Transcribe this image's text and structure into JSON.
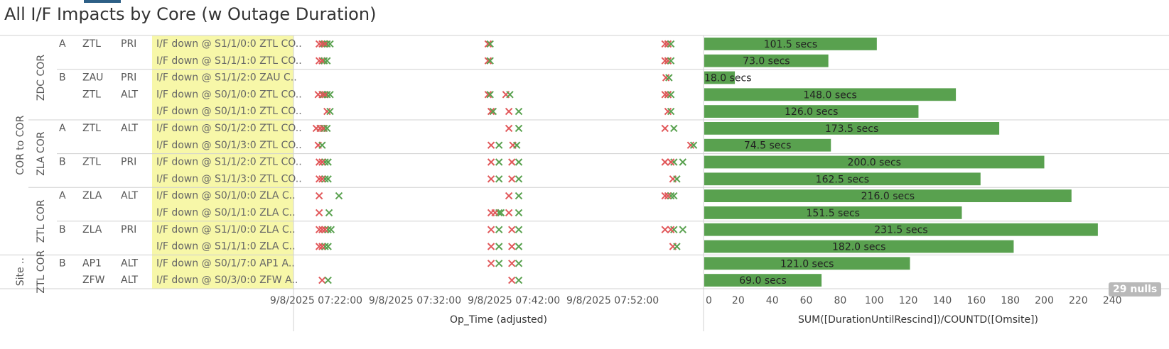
{
  "title": "All I/F Impacts by Core (w Outage Duration)",
  "null_badge": "29 nulls",
  "colors": {
    "bar": "#59a14f",
    "down_x": "#e15759",
    "up_x": "#59a14f",
    "highlight": "#f7f7a8"
  },
  "groups": [
    {
      "label": "COR to COR",
      "sub": [
        {
          "label": "ZDC COR",
          "sides": [
            {
              "label": "A",
              "rows": [
                0,
                1
              ]
            },
            {
              "label": "B",
              "rows": [
                2,
                3,
                4
              ]
            }
          ]
        },
        {
          "label": "ZLA COR",
          "sides": [
            {
              "label": "A",
              "rows": [
                5,
                6
              ]
            },
            {
              "label": "B",
              "rows": [
                7,
                8
              ]
            }
          ]
        },
        {
          "label": "ZTL COR",
          "sides": [
            {
              "label": "A",
              "rows": [
                9,
                10
              ]
            },
            {
              "label": "B",
              "rows": [
                11,
                12
              ]
            }
          ]
        }
      ]
    },
    {
      "label": "Site ..",
      "sub": [
        {
          "label": "ZTL COR",
          "sides": [
            {
              "label": "B",
              "rows": [
                13,
                14
              ]
            }
          ]
        }
      ]
    }
  ],
  "site_cells": [
    {
      "label": "ZTL",
      "rows": [
        0,
        1
      ]
    },
    {
      "label": "ZAU",
      "rows": [
        2
      ]
    },
    {
      "label": "ZTL",
      "rows": [
        3,
        4
      ]
    },
    {
      "label": "ZTL",
      "rows": [
        5,
        6
      ]
    },
    {
      "label": "ZTL",
      "rows": [
        7,
        8
      ]
    },
    {
      "label": "ZLA",
      "rows": [
        9,
        10
      ]
    },
    {
      "label": "ZLA",
      "rows": [
        11,
        12
      ]
    },
    {
      "label": "AP1",
      "rows": [
        13
      ]
    },
    {
      "label": "ZFW",
      "rows": [
        14
      ]
    }
  ],
  "role_cells": [
    {
      "label": "PRI",
      "rows": [
        0,
        1
      ]
    },
    {
      "label": "PRI",
      "rows": [
        2
      ]
    },
    {
      "label": "ALT",
      "rows": [
        3,
        4
      ]
    },
    {
      "label": "ALT",
      "rows": [
        5,
        6
      ]
    },
    {
      "label": "PRI",
      "rows": [
        7,
        8
      ]
    },
    {
      "label": "ALT",
      "rows": [
        9,
        10
      ]
    },
    {
      "label": "PRI",
      "rows": [
        11,
        12
      ]
    },
    {
      "label": "ALT",
      "rows": [
        13
      ]
    },
    {
      "label": "ALT",
      "rows": [
        14
      ]
    }
  ],
  "interface_labels": [
    "I/F down @ S1/1/0:0 ZTL CO..",
    "I/F down @ S1/1/1:0 ZTL CO..",
    "I/F down @ S1/1/2:0 ZAU C..",
    "I/F down @ S0/1/0:0 ZTL CO..",
    "I/F down @ S0/1/1:0 ZTL CO..",
    "I/F down @ S0/1/2:0 ZTL CO..",
    "I/F down @ S0/1/3:0 ZTL CO..",
    "I/F down @ S1/1/2:0 ZTL CO..",
    "I/F down @ S1/1/3:0 ZTL CO..",
    "I/F down @ S0/1/0:0 ZLA C..",
    "I/F down @ S0/1/1:0 ZLA C..",
    "I/F down @ S1/1/0:0 ZLA C..",
    "I/F down @ S1/1/1:0 ZLA C..",
    "I/F down @ S0/1/7:0 AP1 A..",
    "I/F down @ S0/3/0:0 ZFW A.."
  ],
  "chart_data": [
    {
      "type": "scatter",
      "xlabel": "Op_Time (adjusted)",
      "x_ticks": [
        "9/8/2025 07:22:00",
        "9/8/2025 07:32:00",
        "9/8/2025 07:42:00",
        "9/8/2025 07:52:00"
      ],
      "x_tick_minutes": [
        22,
        32,
        42,
        52
      ],
      "x_range_minutes": [
        19.7,
        61.2
      ],
      "marker": "x",
      "series_note_colors": [
        "down_x",
        "up_x"
      ],
      "events": [
        [
          [
            22.3,
            22.8
          ],
          [
            22.6,
            23.1
          ],
          [
            22.9,
            23.4
          ],
          [
            39.4,
            39.6
          ],
          [
            57.3,
            57.6
          ],
          [
            57.6,
            57.9
          ]
        ],
        [
          [
            22.3,
            22.8
          ],
          [
            22.6,
            23.1
          ],
          [
            39.4,
            39.6
          ],
          [
            57.3,
            57.6
          ],
          [
            57.6,
            57.9
          ]
        ],
        [
          [
            57.4,
            57.7
          ]
        ],
        [
          [
            22.2,
            22.7
          ],
          [
            22.6,
            23.1
          ],
          [
            22.9,
            23.4
          ],
          [
            39.4,
            39.6
          ],
          [
            41.2,
            41.6
          ],
          [
            57.3,
            57.6
          ],
          [
            57.6,
            57.9
          ]
        ],
        [
          [
            23.1,
            23.4
          ],
          [
            39.7,
            39.9
          ],
          [
            41.5,
            42.5
          ],
          [
            57.6,
            57.9
          ]
        ],
        [
          [
            22.0,
            22.4
          ],
          [
            22.4,
            22.8
          ],
          [
            22.7,
            23.1
          ],
          [
            41.5,
            42.5
          ],
          [
            57.3,
            58.2
          ]
        ],
        [
          [
            22.2,
            22.6
          ],
          [
            39.7,
            40.5
          ],
          [
            41.9,
            42.3
          ],
          [
            59.9,
            60.2
          ]
        ],
        [
          [
            22.3,
            22.9
          ],
          [
            22.6,
            23.2
          ],
          [
            39.7,
            40.5
          ],
          [
            41.8,
            42.5
          ],
          [
            57.3,
            58.2
          ],
          [
            57.9,
            59.1
          ]
        ],
        [
          [
            22.3,
            22.9
          ],
          [
            22.6,
            23.2
          ],
          [
            39.7,
            40.5
          ],
          [
            41.8,
            42.5
          ],
          [
            58.1,
            58.5
          ]
        ],
        [
          [
            22.3,
            24.3
          ],
          [
            41.5,
            42.5
          ],
          [
            57.3,
            57.9
          ],
          [
            57.6,
            58.2
          ]
        ],
        [
          [
            22.3,
            23.3
          ],
          [
            39.7,
            40.5
          ],
          [
            40.1,
            40.7
          ],
          [
            41.5,
            42.5
          ]
        ],
        [
          [
            22.3,
            22.9
          ],
          [
            22.6,
            23.2
          ],
          [
            22.9,
            23.5
          ],
          [
            39.7,
            40.5
          ],
          [
            41.8,
            42.5
          ],
          [
            57.3,
            58.2
          ],
          [
            57.9,
            59.1
          ]
        ],
        [
          [
            22.3,
            22.9
          ],
          [
            22.6,
            23.2
          ],
          [
            39.7,
            40.5
          ],
          [
            41.8,
            42.5
          ],
          [
            58.1,
            58.5
          ]
        ],
        [
          [
            39.7,
            40.5
          ],
          [
            41.8,
            42.5
          ]
        ],
        [
          [
            22.6,
            23.2
          ],
          [
            41.8,
            42.5
          ]
        ]
      ]
    },
    {
      "type": "bar",
      "orientation": "horizontal",
      "xlabel": "SUM([DurationUntilRescind])/COUNTD([Omsite])",
      "x_ticks": [
        0,
        20,
        40,
        60,
        80,
        100,
        120,
        140,
        160,
        180,
        200,
        220,
        240
      ],
      "xlim": [
        0,
        242
      ],
      "values": [
        101.5,
        73.0,
        18.0,
        148.0,
        126.0,
        173.5,
        74.5,
        200.0,
        162.5,
        216.0,
        151.5,
        231.5,
        182.0,
        121.0,
        69.0
      ],
      "value_labels": [
        "101.5 secs",
        "73.0 secs",
        "18.0 secs",
        "148.0 secs",
        "126.0 secs",
        "173.5 secs",
        "74.5 secs",
        "200.0 secs",
        "162.5 secs",
        "216.0 secs",
        "151.5 secs",
        "231.5 secs",
        "182.0 secs",
        "121.0 secs",
        "69.0 secs"
      ]
    }
  ]
}
